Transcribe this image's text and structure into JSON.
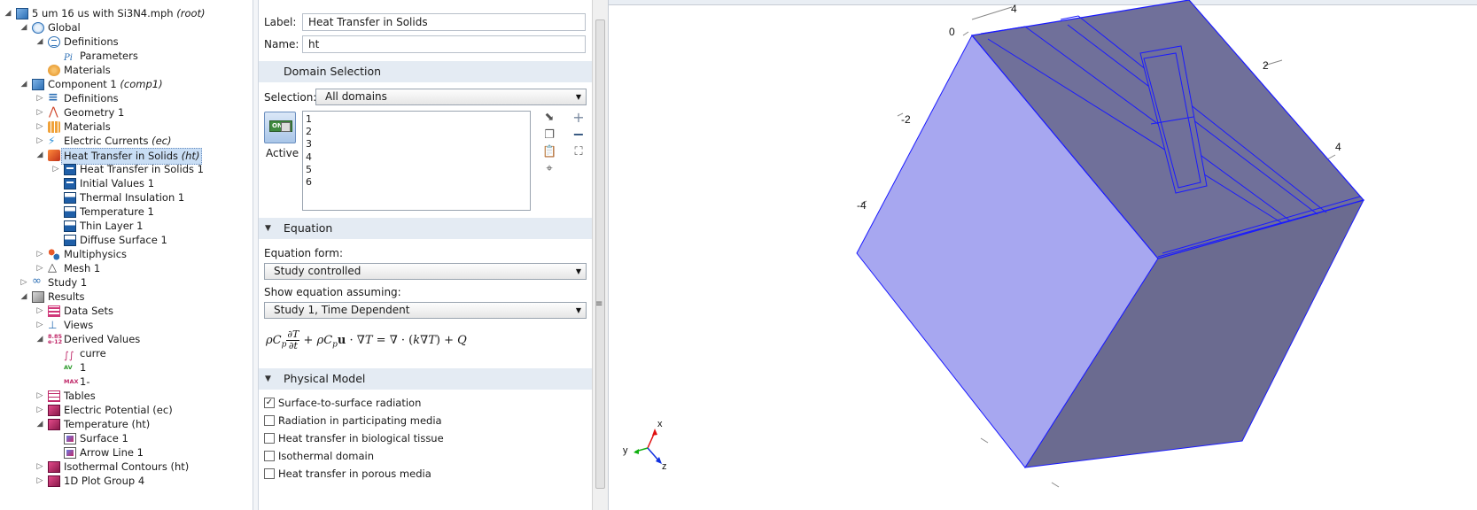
{
  "tree": {
    "rows": [
      {
        "label": "5 um 16 us with Si3N4.mph",
        "suffix": "(root)",
        "icon": "model-icon",
        "depth": 0,
        "twisty": "open"
      },
      {
        "label": "Global",
        "suffix": "",
        "icon": "globe-icon",
        "depth": 1,
        "twisty": "open"
      },
      {
        "label": "Definitions",
        "suffix": "",
        "icon": "definitions-icon",
        "depth": 2,
        "twisty": "open"
      },
      {
        "label": "Parameters",
        "suffix": "",
        "icon": "parameters-icon",
        "depth": 3,
        "twisty": ""
      },
      {
        "label": "Materials",
        "suffix": "",
        "icon": "materials-icon",
        "depth": 2,
        "twisty": ""
      },
      {
        "label": "Component 1",
        "suffix": "(comp1)",
        "icon": "component-icon",
        "depth": 1,
        "twisty": "open"
      },
      {
        "label": "Definitions",
        "suffix": "",
        "icon": "definitions-list-icon",
        "depth": 2,
        "twisty": "closed"
      },
      {
        "label": "Geometry 1",
        "suffix": "",
        "icon": "geometry-icon",
        "depth": 2,
        "twisty": "closed"
      },
      {
        "label": "Materials",
        "suffix": "",
        "icon": "materials-grid-icon",
        "depth": 2,
        "twisty": "closed"
      },
      {
        "label": "Electric Currents",
        "suffix": "(ec)",
        "icon": "electric-currents-icon",
        "depth": 2,
        "twisty": "closed"
      },
      {
        "label": "Heat Transfer in Solids",
        "suffix": "(ht)",
        "icon": "heat-transfer-icon",
        "depth": 2,
        "twisty": "open",
        "selected": true
      },
      {
        "label": "Heat Transfer in Solids 1",
        "suffix": "",
        "icon": "domain-node-icon",
        "depth": 3,
        "twisty": "closed"
      },
      {
        "label": "Initial Values 1",
        "suffix": "",
        "icon": "domain-node-icon",
        "depth": 3,
        "twisty": ""
      },
      {
        "label": "Thermal Insulation 1",
        "suffix": "",
        "icon": "boundary-node-icon",
        "depth": 3,
        "twisty": ""
      },
      {
        "label": "Temperature 1",
        "suffix": "",
        "icon": "boundary-node-icon",
        "depth": 3,
        "twisty": ""
      },
      {
        "label": "Thin Layer 1",
        "suffix": "",
        "icon": "boundary-node-icon",
        "depth": 3,
        "twisty": ""
      },
      {
        "label": "Diffuse Surface 1",
        "suffix": "",
        "icon": "boundary-node-icon",
        "depth": 3,
        "twisty": ""
      },
      {
        "label": "Multiphysics",
        "suffix": "",
        "icon": "multiphysics-icon",
        "depth": 2,
        "twisty": "closed"
      },
      {
        "label": "Mesh 1",
        "suffix": "",
        "icon": "mesh-icon",
        "depth": 2,
        "twisty": "closed"
      },
      {
        "label": "Study 1",
        "suffix": "",
        "icon": "study-icon",
        "depth": 1,
        "twisty": "closed"
      },
      {
        "label": "Results",
        "suffix": "",
        "icon": "results-icon",
        "depth": 1,
        "twisty": "open"
      },
      {
        "label": "Data Sets",
        "suffix": "",
        "icon": "data-sets-icon",
        "depth": 2,
        "twisty": "closed"
      },
      {
        "label": "Views",
        "suffix": "",
        "icon": "views-icon",
        "depth": 2,
        "twisty": "closed"
      },
      {
        "label": "Derived Values",
        "suffix": "",
        "icon": "derived-values-icon",
        "depth": 2,
        "twisty": "open"
      },
      {
        "label": "curre",
        "suffix": "",
        "icon": "integration-icon",
        "depth": 3,
        "twisty": ""
      },
      {
        "label": "1",
        "suffix": "",
        "icon": "average-icon",
        "depth": 3,
        "twisty": ""
      },
      {
        "label": "1-",
        "suffix": "",
        "icon": "maximum-icon",
        "depth": 3,
        "twisty": ""
      },
      {
        "label": "Tables",
        "suffix": "",
        "icon": "tables-icon",
        "depth": 2,
        "twisty": "closed"
      },
      {
        "label": "Electric Potential (ec)",
        "suffix": "",
        "icon": "plot-group-icon",
        "depth": 2,
        "twisty": "closed"
      },
      {
        "label": "Temperature (ht)",
        "suffix": "",
        "icon": "plot-group-icon",
        "depth": 2,
        "twisty": "open"
      },
      {
        "label": "Surface 1",
        "suffix": "",
        "icon": "surface-plot-icon",
        "depth": 3,
        "twisty": ""
      },
      {
        "label": "Arrow Line 1",
        "suffix": "",
        "icon": "arrow-line-icon",
        "depth": 3,
        "twisty": ""
      },
      {
        "label": "Isothermal Contours (ht)",
        "suffix": "",
        "icon": "plot-group-icon",
        "depth": 2,
        "twisty": "closed"
      },
      {
        "label": "1D Plot Group 4",
        "suffix": "",
        "icon": "plot-group-icon",
        "depth": 2,
        "twisty": "closed"
      }
    ]
  },
  "settings": {
    "label_caption": "Label:",
    "label_value": "Heat Transfer in Solids",
    "name_caption": "Name:",
    "name_value": "ht",
    "domain_selection": {
      "title": "Domain Selection",
      "selection_caption": "Selection:",
      "selection_value": "All domains",
      "domains": [
        "1",
        "2",
        "3",
        "4",
        "5",
        "6"
      ],
      "active_label": "Active",
      "toggle_text": "ON"
    },
    "equation": {
      "title": "Equation",
      "form_caption": "Equation form:",
      "form_value": "Study controlled",
      "assume_caption": "Show equation assuming:",
      "assume_value": "Study 1, Time Dependent"
    },
    "physical_model": {
      "title": "Physical Model",
      "options": [
        {
          "label": "Surface-to-surface radiation",
          "checked": true
        },
        {
          "label": "Radiation in participating media",
          "checked": false
        },
        {
          "label": "Heat transfer in biological tissue",
          "checked": false
        },
        {
          "label": "Isothermal domain",
          "checked": false
        },
        {
          "label": "Heat transfer in porous media",
          "checked": false
        }
      ]
    }
  },
  "graphics": {
    "axis_ticks": [
      "4",
      "0",
      "2",
      "-2",
      "4",
      "-4"
    ],
    "triad": {
      "x": "x",
      "y": "y",
      "z": "z"
    },
    "colors": {
      "top_face": "#70709a",
      "left_face": "#a7a7f0",
      "right_face": "#6b6b90",
      "edge": "#1a1aff"
    }
  }
}
